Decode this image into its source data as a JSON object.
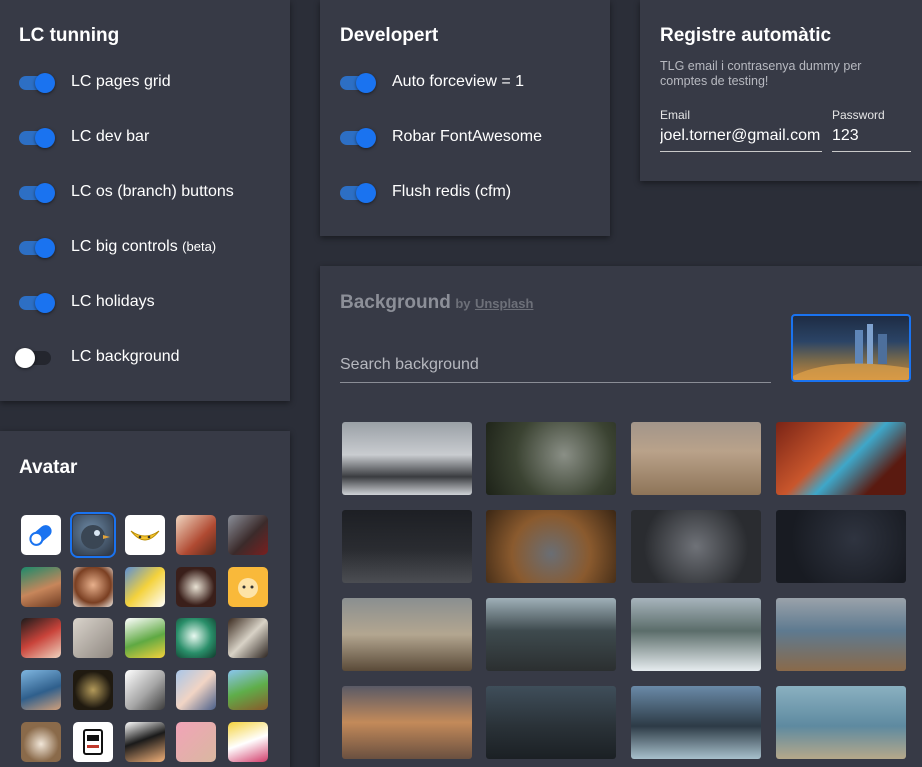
{
  "lc_tunning": {
    "title": "LC tunning",
    "toggles": [
      {
        "label": "LC pages grid",
        "suffix": "",
        "on": true
      },
      {
        "label": "LC dev bar",
        "suffix": "",
        "on": true
      },
      {
        "label": "LC os (branch) buttons",
        "suffix": "",
        "on": true
      },
      {
        "label": "LC big controls",
        "suffix": "(beta)",
        "on": true
      },
      {
        "label": "LC holidays",
        "suffix": "",
        "on": true
      },
      {
        "label": "LC background",
        "suffix": "",
        "on": false
      }
    ]
  },
  "developert": {
    "title": "Developert",
    "toggles": [
      {
        "label": "Auto forceview = 1",
        "on": true
      },
      {
        "label": "Robar FontAwesome",
        "on": true
      },
      {
        "label": "Flush redis (cfm)",
        "on": true
      }
    ]
  },
  "registre": {
    "title": "Registre automàtic",
    "description": "TLG email i contrasenya dummy per comptes de testing!",
    "email_label": "Email",
    "email_value": "joel.torner@gmail.com",
    "password_label": "Password",
    "password_value": "123"
  },
  "avatar": {
    "title": "Avatar",
    "selected_index": 1
  },
  "background": {
    "title": "Background",
    "by_text": "by",
    "source_link": "Unsplash",
    "search_placeholder": "Search background"
  },
  "colors": {
    "accent": "#1a73f0",
    "panel": "#373a46",
    "page": "#2b2e38"
  }
}
